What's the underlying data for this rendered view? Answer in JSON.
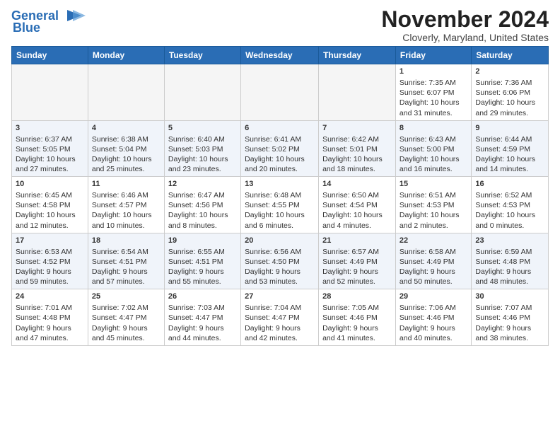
{
  "title": "November 2024",
  "location": "Cloverly, Maryland, United States",
  "logo_line1": "General",
  "logo_line2": "Blue",
  "days_of_week": [
    "Sunday",
    "Monday",
    "Tuesday",
    "Wednesday",
    "Thursday",
    "Friday",
    "Saturday"
  ],
  "weeks": [
    [
      {
        "day": "",
        "info": ""
      },
      {
        "day": "",
        "info": ""
      },
      {
        "day": "",
        "info": ""
      },
      {
        "day": "",
        "info": ""
      },
      {
        "day": "",
        "info": ""
      },
      {
        "day": "1",
        "info": "Sunrise: 7:35 AM\nSunset: 6:07 PM\nDaylight: 10 hours\nand 31 minutes."
      },
      {
        "day": "2",
        "info": "Sunrise: 7:36 AM\nSunset: 6:06 PM\nDaylight: 10 hours\nand 29 minutes."
      }
    ],
    [
      {
        "day": "3",
        "info": "Sunrise: 6:37 AM\nSunset: 5:05 PM\nDaylight: 10 hours\nand 27 minutes."
      },
      {
        "day": "4",
        "info": "Sunrise: 6:38 AM\nSunset: 5:04 PM\nDaylight: 10 hours\nand 25 minutes."
      },
      {
        "day": "5",
        "info": "Sunrise: 6:40 AM\nSunset: 5:03 PM\nDaylight: 10 hours\nand 23 minutes."
      },
      {
        "day": "6",
        "info": "Sunrise: 6:41 AM\nSunset: 5:02 PM\nDaylight: 10 hours\nand 20 minutes."
      },
      {
        "day": "7",
        "info": "Sunrise: 6:42 AM\nSunset: 5:01 PM\nDaylight: 10 hours\nand 18 minutes."
      },
      {
        "day": "8",
        "info": "Sunrise: 6:43 AM\nSunset: 5:00 PM\nDaylight: 10 hours\nand 16 minutes."
      },
      {
        "day": "9",
        "info": "Sunrise: 6:44 AM\nSunset: 4:59 PM\nDaylight: 10 hours\nand 14 minutes."
      }
    ],
    [
      {
        "day": "10",
        "info": "Sunrise: 6:45 AM\nSunset: 4:58 PM\nDaylight: 10 hours\nand 12 minutes."
      },
      {
        "day": "11",
        "info": "Sunrise: 6:46 AM\nSunset: 4:57 PM\nDaylight: 10 hours\nand 10 minutes."
      },
      {
        "day": "12",
        "info": "Sunrise: 6:47 AM\nSunset: 4:56 PM\nDaylight: 10 hours\nand 8 minutes."
      },
      {
        "day": "13",
        "info": "Sunrise: 6:48 AM\nSunset: 4:55 PM\nDaylight: 10 hours\nand 6 minutes."
      },
      {
        "day": "14",
        "info": "Sunrise: 6:50 AM\nSunset: 4:54 PM\nDaylight: 10 hours\nand 4 minutes."
      },
      {
        "day": "15",
        "info": "Sunrise: 6:51 AM\nSunset: 4:53 PM\nDaylight: 10 hours\nand 2 minutes."
      },
      {
        "day": "16",
        "info": "Sunrise: 6:52 AM\nSunset: 4:53 PM\nDaylight: 10 hours\nand 0 minutes."
      }
    ],
    [
      {
        "day": "17",
        "info": "Sunrise: 6:53 AM\nSunset: 4:52 PM\nDaylight: 9 hours\nand 59 minutes."
      },
      {
        "day": "18",
        "info": "Sunrise: 6:54 AM\nSunset: 4:51 PM\nDaylight: 9 hours\nand 57 minutes."
      },
      {
        "day": "19",
        "info": "Sunrise: 6:55 AM\nSunset: 4:51 PM\nDaylight: 9 hours\nand 55 minutes."
      },
      {
        "day": "20",
        "info": "Sunrise: 6:56 AM\nSunset: 4:50 PM\nDaylight: 9 hours\nand 53 minutes."
      },
      {
        "day": "21",
        "info": "Sunrise: 6:57 AM\nSunset: 4:49 PM\nDaylight: 9 hours\nand 52 minutes."
      },
      {
        "day": "22",
        "info": "Sunrise: 6:58 AM\nSunset: 4:49 PM\nDaylight: 9 hours\nand 50 minutes."
      },
      {
        "day": "23",
        "info": "Sunrise: 6:59 AM\nSunset: 4:48 PM\nDaylight: 9 hours\nand 48 minutes."
      }
    ],
    [
      {
        "day": "24",
        "info": "Sunrise: 7:01 AM\nSunset: 4:48 PM\nDaylight: 9 hours\nand 47 minutes."
      },
      {
        "day": "25",
        "info": "Sunrise: 7:02 AM\nSunset: 4:47 PM\nDaylight: 9 hours\nand 45 minutes."
      },
      {
        "day": "26",
        "info": "Sunrise: 7:03 AM\nSunset: 4:47 PM\nDaylight: 9 hours\nand 44 minutes."
      },
      {
        "day": "27",
        "info": "Sunrise: 7:04 AM\nSunset: 4:47 PM\nDaylight: 9 hours\nand 42 minutes."
      },
      {
        "day": "28",
        "info": "Sunrise: 7:05 AM\nSunset: 4:46 PM\nDaylight: 9 hours\nand 41 minutes."
      },
      {
        "day": "29",
        "info": "Sunrise: 7:06 AM\nSunset: 4:46 PM\nDaylight: 9 hours\nand 40 minutes."
      },
      {
        "day": "30",
        "info": "Sunrise: 7:07 AM\nSunset: 4:46 PM\nDaylight: 9 hours\nand 38 minutes."
      }
    ]
  ]
}
